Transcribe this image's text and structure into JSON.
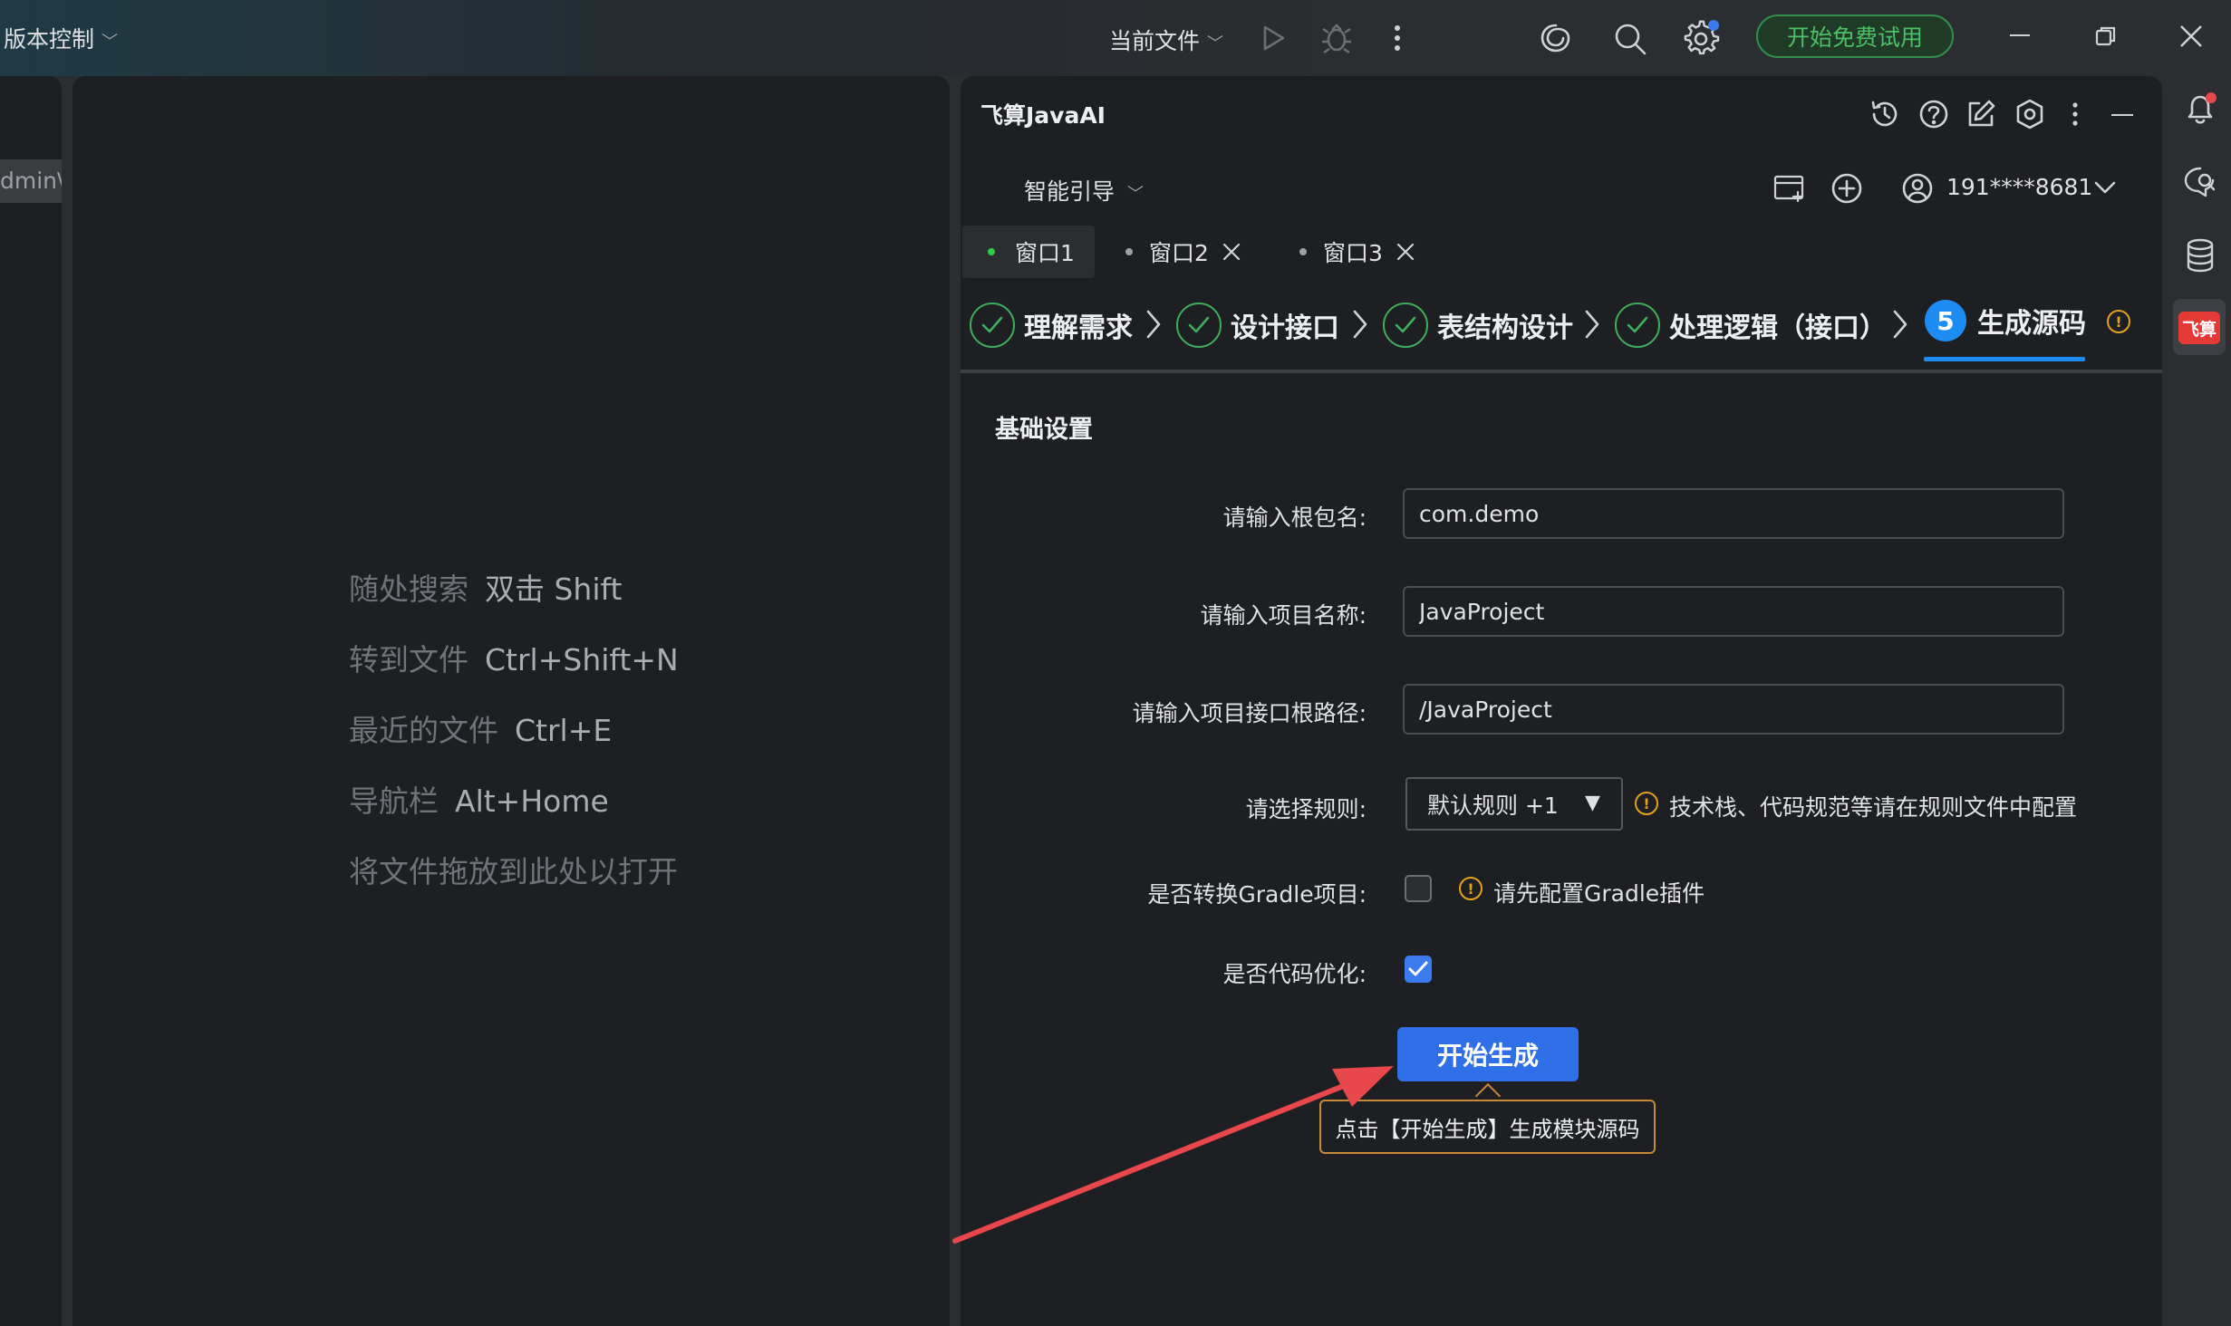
{
  "title_bar": {
    "vcs_menu": "版本控制",
    "run_config": "当前文件",
    "trial_button": "开始免费试用"
  },
  "left_panel": {
    "breadcrumb": "dmin\\"
  },
  "editor_hints": [
    {
      "label": "随处搜索",
      "key": "双击 Shift"
    },
    {
      "label": "转到文件",
      "key": "Ctrl+Shift+N"
    },
    {
      "label": "最近的文件",
      "key": "Ctrl+E"
    },
    {
      "label": "导航栏",
      "key": "Alt+Home"
    },
    {
      "label": "将文件拖放到此处以打开",
      "key": ""
    }
  ],
  "ai_panel": {
    "title": "飞算JavaAI",
    "mode_dropdown": "智能引导",
    "user_account": "191****8681",
    "tabs": [
      {
        "label": "窗口1",
        "active": true
      },
      {
        "label": "窗口2",
        "active": false
      },
      {
        "label": "窗口3",
        "active": false
      }
    ],
    "steps": [
      "理解需求",
      "设计接口",
      "表结构设计",
      "处理逻辑（接口）",
      "生成源码"
    ],
    "current_step_number": "5",
    "section_title": "基础设置",
    "form": {
      "root_package_label": "请输入根包名:",
      "root_package_value": "com.demo",
      "project_name_label": "请输入项目名称:",
      "project_name_value": "JavaProject",
      "api_root_label": "请输入项目接口根路径:",
      "api_root_value": "/JavaProject",
      "rule_label": "请选择规则:",
      "rule_value": "默认规则 +1",
      "rule_hint": "技术栈、代码规范等请在规则文件中配置",
      "gradle_label": "是否转换Gradle项目:",
      "gradle_checked": false,
      "gradle_hint": "请先配置Gradle插件",
      "optimize_label": "是否代码优化:",
      "optimize_checked": true
    },
    "start_button": "开始生成",
    "tooltip": "点击【开始生成】生成模块源码"
  },
  "right_strip": {
    "plugin_logo": "飞算"
  },
  "colors": {
    "accent_blue": "#2f6fe8",
    "step_blue": "#1c8cf3",
    "success_green": "#3fae5d",
    "warning_orange": "#e3a21a",
    "arrow_red": "#e8474b"
  }
}
